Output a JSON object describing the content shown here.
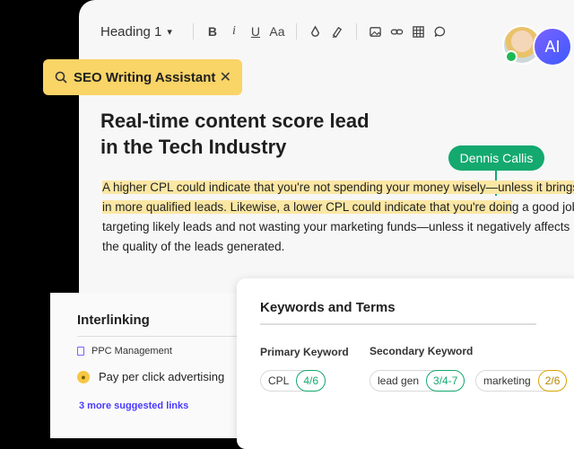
{
  "editor": {
    "toolbar": {
      "heading": "Heading 1",
      "heading_caret": "▾",
      "bold": "B",
      "italic": "i",
      "underline": "U",
      "case": "Aa",
      "icons": [
        "ink-icon",
        "highlighter-icon",
        "image-icon",
        "link-icon",
        "table-icon",
        "comment-icon"
      ]
    },
    "avatars": {
      "ai_label": "AI",
      "online_color": "#1db954"
    },
    "seo_assistant": {
      "label": "SEO Writing Assistant",
      "close": "✕",
      "color": "#f9d466"
    },
    "title_line1": "Real-time content score lead",
    "title_line2": "in the Tech Industry",
    "comment_author": "Dennis Callis",
    "paragraph": {
      "line1": "A higher CPL could indicate that you're not spending your money wisely—unless it brings",
      "line2_hl": "in more qualified leads. Likewise, a lower CPL could indicate that you're doin",
      "line2_rest": "g a good job",
      "line3": "targeting likely leads and not wasting your marketing funds—unless it negatively affects",
      "line4": "the quality of the leads generated."
    },
    "highlight_color": "#fbe7a4"
  },
  "interlinking": {
    "title": "Interlinking",
    "doc_label": "PPC Management",
    "suggestion": "Pay per click advertising",
    "more": "3 more suggested links"
  },
  "keywords": {
    "title": "Keywords and Terms",
    "primary_label": "Primary Keyword",
    "secondary_label": "Secondary Keyword",
    "primary": [
      {
        "term": "CPL",
        "score": "4/6",
        "status": "green"
      }
    ],
    "secondary": [
      {
        "term": "lead gen",
        "score": "3/4-7",
        "status": "green"
      },
      {
        "term": "marketing",
        "score": "2/6",
        "status": "yellow"
      }
    ],
    "colors": {
      "green": "#14a96f",
      "yellow": "#d9a400"
    }
  }
}
